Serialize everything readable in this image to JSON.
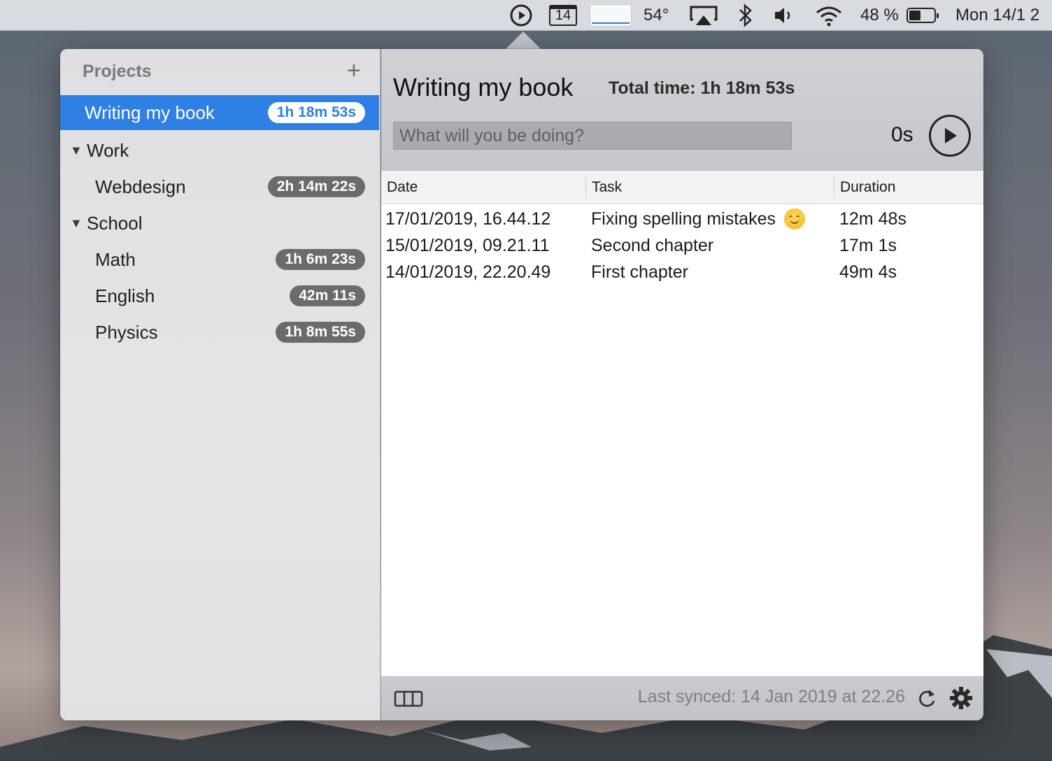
{
  "menubar": {
    "calendar_day": "14",
    "temperature": "54°",
    "battery_percent": "48 %",
    "battery_level": 0.48,
    "clock": "Mon 14/1 2",
    "icons": [
      "play-circle-icon",
      "calendar-icon",
      "activity-graph-icon",
      "airplay-icon",
      "bluetooth-icon",
      "volume-icon",
      "wifi-icon",
      "battery-icon"
    ]
  },
  "sidebar": {
    "header": "Projects",
    "add_label": "+",
    "selected_project": {
      "label": "Writing my book",
      "time": "1h 18m 53s"
    },
    "groups": [
      {
        "label": "Work",
        "items": [
          {
            "label": "Webdesign",
            "time": "2h 14m 22s"
          }
        ]
      },
      {
        "label": "School",
        "items": [
          {
            "label": "Math",
            "time": "1h 6m 23s"
          },
          {
            "label": "English",
            "time": "42m 11s"
          },
          {
            "label": "Physics",
            "time": "1h 8m 55s"
          }
        ]
      }
    ]
  },
  "main": {
    "title": "Writing my book",
    "total_time": "Total time: 1h 18m 53s",
    "task_placeholder": "What will you be doing?",
    "elapsed": "0s",
    "columns": [
      "Date",
      "Task",
      "Duration"
    ],
    "rows": [
      {
        "date": "17/01/2019, 16.44.12",
        "task": "Fixing spelling mistakes",
        "emoji": "smiling-face",
        "duration": "12m 48s"
      },
      {
        "date": "15/01/2019, 09.21.11",
        "task": "Second chapter",
        "duration": "17m 1s"
      },
      {
        "date": "14/01/2019, 22.20.49",
        "task": "First chapter",
        "duration": "49m 4s"
      }
    ],
    "footer": {
      "last_synced": "Last synced: 14 Jan 2019 at 22.26"
    }
  },
  "colors": {
    "accent": "#2f80e4",
    "badge": "#6b6b6d"
  }
}
